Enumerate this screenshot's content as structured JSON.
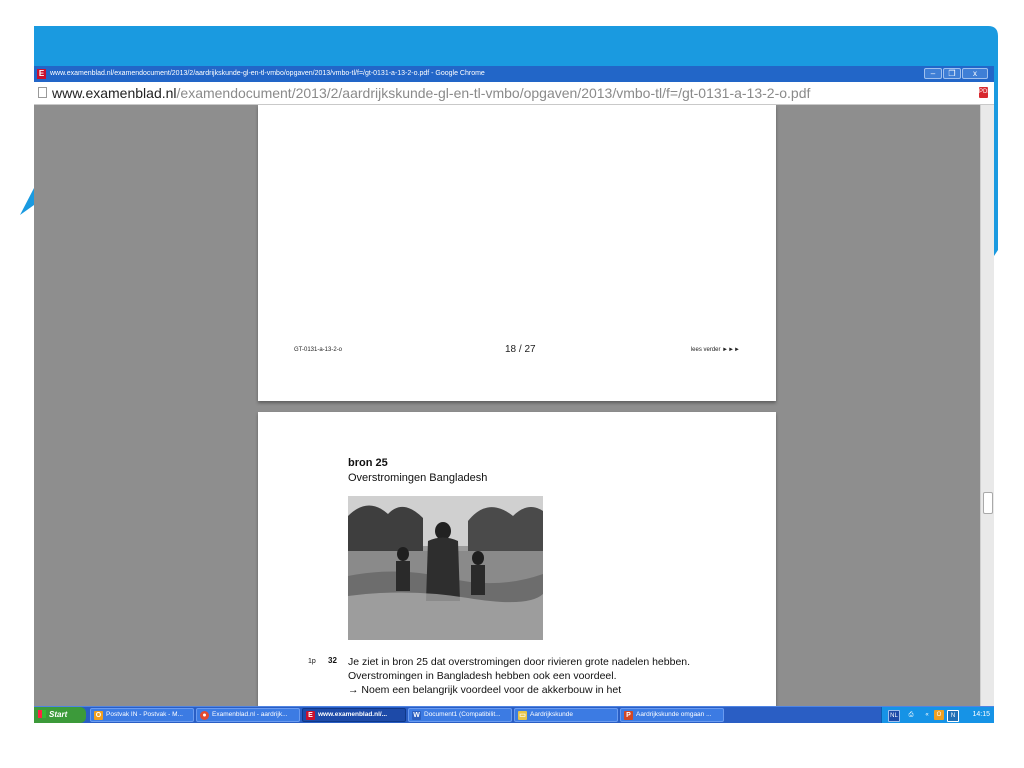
{
  "window": {
    "title": "www.examenblad.nl/examendocument/2013/2/aardrijkskunde-gl-en-tl-vmbo/opgaven/2013/vmbo-tl/f=/gt-0131-a-13-2-o.pdf - Google Chrome",
    "app_icon_letter": "E",
    "minimize": "–",
    "maximize": "❐",
    "close": "x"
  },
  "address_bar": {
    "host": "www.examenblad.nl",
    "path": "/examendocument/2013/2/aardrijkskunde-gl-en-tl-vmbo/opgaven/2013/vmbo-tl/f=/gt-0131-a-13-2-o.pdf",
    "pdf_icon_label": "PDF"
  },
  "pdf": {
    "page1_footer": {
      "code": "GT-0131-a-13-2-o",
      "page_number": "18 / 27",
      "continue": "lees verder ►►►"
    },
    "page2": {
      "source_title": "bron 25",
      "source_subtitle": "Overstromingen Bangladesh",
      "question_points": "1p",
      "question_number": "32",
      "question_lines": [
        "Je ziet in bron 25 dat overstromingen door rivieren grote nadelen hebben.",
        "Overstromingen in Bangladesh hebben ook een voordeel.",
        "→  Noem een belangrijk voordeel voor de akkerbouw in het"
      ]
    }
  },
  "taskbar": {
    "start": "Start",
    "tasks": [
      {
        "label": "Postvak IN - Postvak - M...",
        "icon": "O",
        "icon_color": "#f0a020"
      },
      {
        "label": "Examenblad.nl - aardrijk...",
        "icon": "●",
        "icon_color": "#e34a2f"
      },
      {
        "label": "www.examenblad.nl/...",
        "icon": "E",
        "icon_color": "#c8102e",
        "active": true
      },
      {
        "label": "Document1 (Compatibilit...",
        "icon": "W",
        "icon_color": "#2b5fc0"
      },
      {
        "label": "Aardrijkskunde",
        "icon": "▭",
        "icon_color": "#e8c54a"
      },
      {
        "label": "Aardrijkskunde omgaan ...",
        "icon": "P",
        "icon_color": "#d24726"
      }
    ],
    "tray": {
      "language": "NL",
      "expand": "«",
      "clock": "14:15"
    }
  },
  "colors": {
    "slide_accent": "#1a9ae0",
    "titlebar": "#2266c8",
    "taskbar": "#2a5ec4"
  }
}
